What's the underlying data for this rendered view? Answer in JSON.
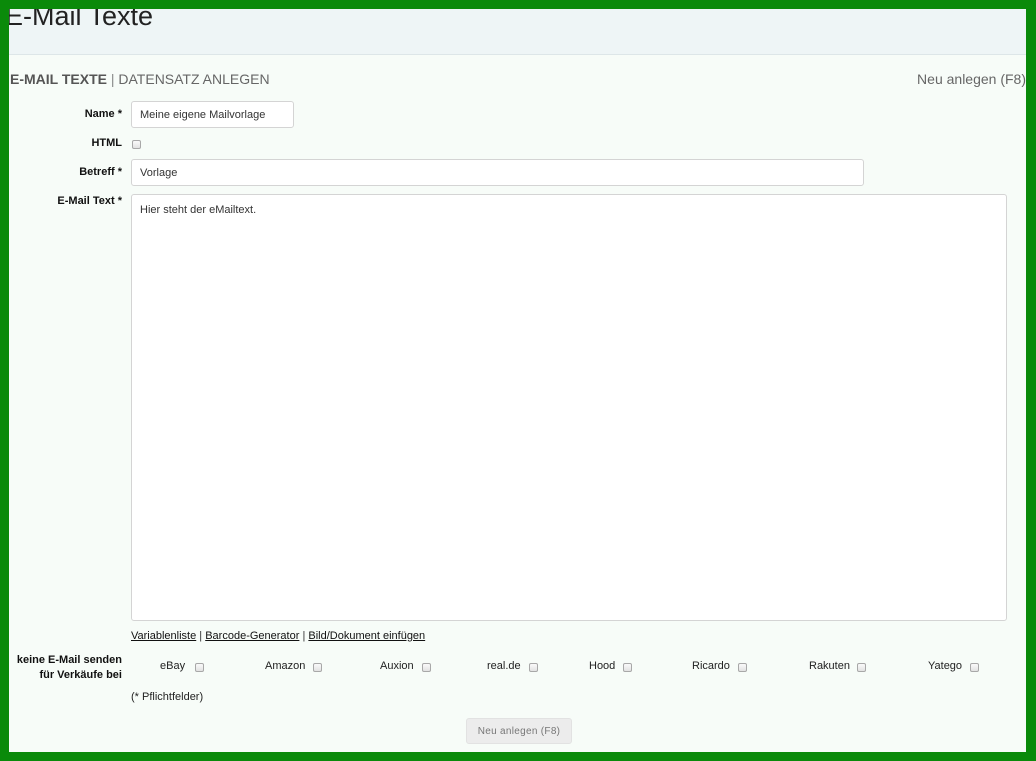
{
  "page": {
    "title": "E-Mail Texte"
  },
  "section": {
    "title_strong": "E-MAIL TEXTE",
    "separator": "|",
    "title_rest": "DATENSATZ ANLEGEN",
    "new_link": "Neu anlegen (F8)"
  },
  "form": {
    "name_label": "Name *",
    "name_value": "Meine eigene Mailvorlage",
    "html_label": "HTML",
    "subject_label": "Betreff *",
    "subject_value": "Vorlage",
    "body_label": "E-Mail Text *",
    "body_value": "Hier steht der eMailtext."
  },
  "links": {
    "variables": "Variablenliste",
    "barcode": "Barcode-Generator",
    "image": "Bild/Dokument einfügen",
    "separator": "|"
  },
  "no_mail": {
    "label_line1": "keine E-Mail senden",
    "label_line2": "für Verkäufe bei",
    "marketplaces": [
      "eBay",
      "Amazon",
      "Auxion",
      "real.de",
      "Hood",
      "Ricardo",
      "Rakuten",
      "Yatego"
    ]
  },
  "required_note": "(* Pflichtfelder)",
  "submit_label": "Neu anlegen (F8)"
}
